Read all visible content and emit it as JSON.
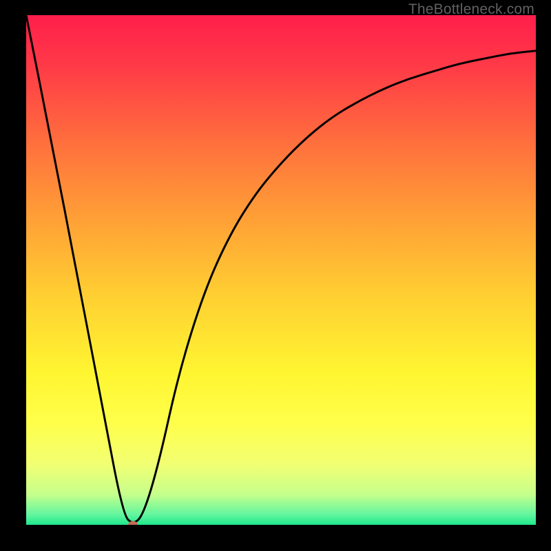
{
  "watermark": "TheBottleneck.com",
  "chart_data": {
    "type": "line",
    "title": "",
    "xlabel": "",
    "ylabel": "",
    "xlim": [
      0,
      100
    ],
    "ylim": [
      0,
      100
    ],
    "grid": false,
    "legend": false,
    "series": [
      {
        "name": "bottleneck-curve",
        "x": [
          0,
          5,
          10,
          15,
          19,
          21,
          23,
          26,
          30,
          35,
          40,
          45,
          50,
          55,
          60,
          65,
          70,
          75,
          80,
          85,
          90,
          95,
          100
        ],
        "y": [
          100,
          75,
          49,
          23,
          2,
          0,
          2,
          12,
          30,
          46,
          57,
          65,
          71,
          76,
          80,
          83,
          85.5,
          87.5,
          89,
          90.5,
          91.5,
          92.5,
          93
        ]
      }
    ],
    "marker": {
      "x": 21,
      "y": 0,
      "color": "#c36b54"
    },
    "background_gradient": {
      "stops": [
        {
          "pos": 0.0,
          "color": "#ff1e4b"
        },
        {
          "pos": 0.1,
          "color": "#ff3a47"
        },
        {
          "pos": 0.25,
          "color": "#ff6f3d"
        },
        {
          "pos": 0.4,
          "color": "#ffa036"
        },
        {
          "pos": 0.55,
          "color": "#ffcf32"
        },
        {
          "pos": 0.7,
          "color": "#fff531"
        },
        {
          "pos": 0.8,
          "color": "#ffff4a"
        },
        {
          "pos": 0.88,
          "color": "#f2ff72"
        },
        {
          "pos": 0.94,
          "color": "#c6ff8c"
        },
        {
          "pos": 0.98,
          "color": "#62f59f"
        },
        {
          "pos": 1.0,
          "color": "#1ee88b"
        }
      ]
    }
  }
}
